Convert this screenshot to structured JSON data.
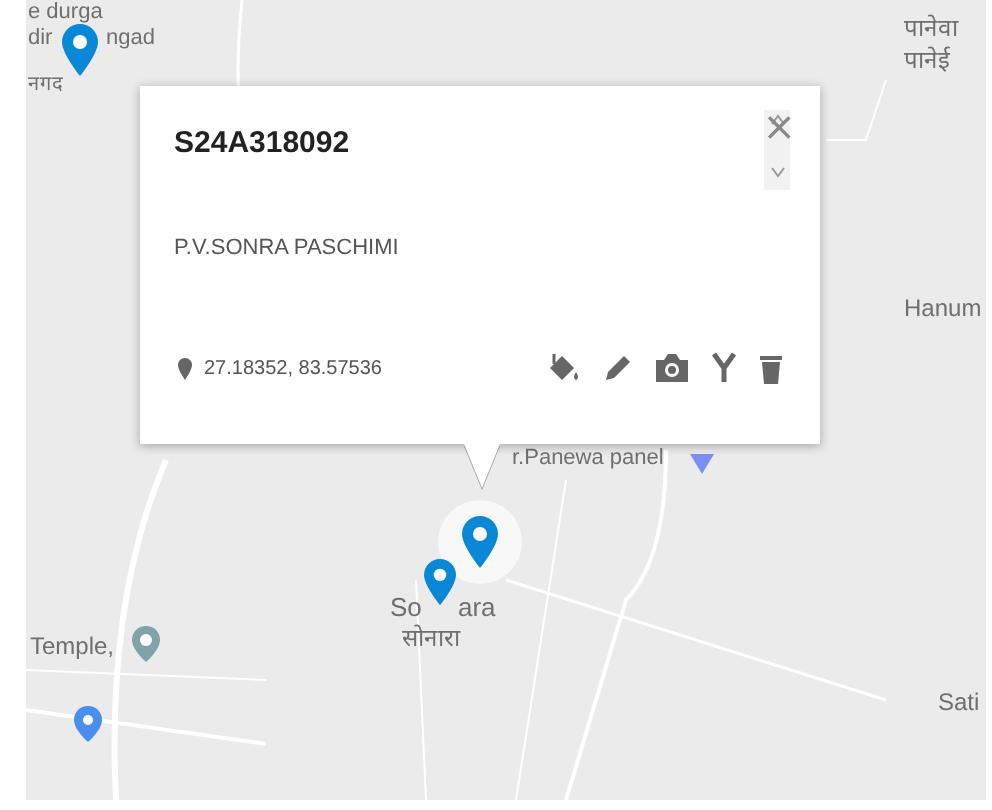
{
  "map": {
    "labels": [
      {
        "text": "e durga"
      },
      {
        "text": "dir"
      },
      {
        "text": "ngad"
      },
      {
        "text": "नगद"
      },
      {
        "text": "पानेवा"
      },
      {
        "text": "पानेई"
      },
      {
        "text": "Hanum"
      },
      {
        "text": "r.Panewa panel"
      },
      {
        "text": "So"
      },
      {
        "text": "ara"
      },
      {
        "text": "सोनारा"
      },
      {
        "text": "Temple,"
      },
      {
        "text": "Sati"
      }
    ]
  },
  "popup": {
    "title": "S24A318092",
    "subtitle": "P.V.SONRA PASCHIMI",
    "coordinates": "27.18352, 83.57536",
    "close": "×"
  }
}
